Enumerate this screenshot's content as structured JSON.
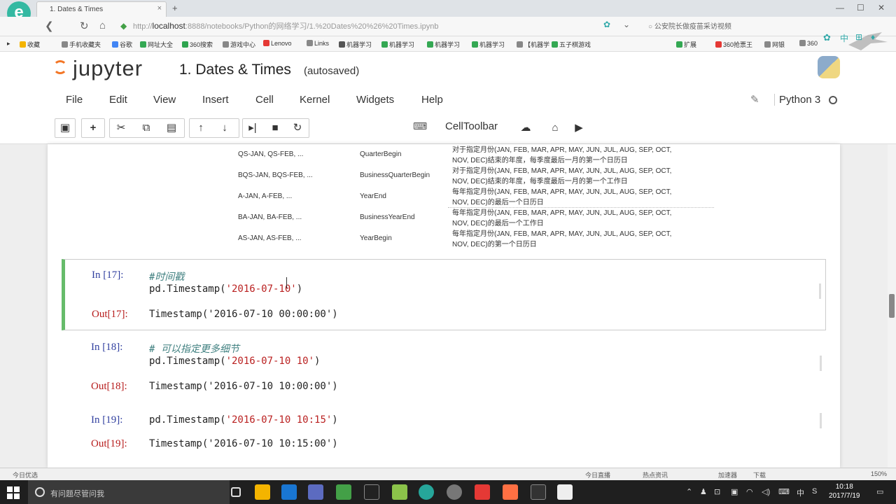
{
  "browser": {
    "tab_title": "1. Dates & Times",
    "tab_close": "×",
    "new_tab": "+",
    "url_scheme": "http://",
    "url_host": "localhost",
    "url_rest": ":8888/notebooks/Python的网络学习/1.%20Dates%20%26%20Times.ipynb",
    "search_text": "公安院长做疫苗采访视频",
    "window_controls": [
      "—",
      "☐",
      "✕"
    ],
    "bookmarks": [
      {
        "label": "收藏",
        "color": "#f4b400"
      },
      {
        "label": "手机收藏夹",
        "color": "#888"
      },
      {
        "label": "谷歌",
        "color": "#4285f4"
      },
      {
        "label": "网址大全",
        "color": "#34a853"
      },
      {
        "label": "360搜索",
        "color": "#2ea44f"
      },
      {
        "label": "游戏中心",
        "color": "#888"
      },
      {
        "label": "Lenovo",
        "color": "#e53935"
      },
      {
        "label": "Links",
        "color": "#888"
      },
      {
        "label": "机器学习",
        "color": "#555"
      },
      {
        "label": "机器学习",
        "color": "#34a853"
      },
      {
        "label": "机器学习",
        "color": "#34a853"
      },
      {
        "label": "机器学习",
        "color": "#34a853"
      },
      {
        "label": "【机器学",
        "color": "#888"
      },
      {
        "label": "五子棋游戏",
        "color": "#34a853"
      },
      {
        "label": "扩展",
        "color": "#34a853"
      },
      {
        "label": "360抢票王",
        "color": "#e53935"
      },
      {
        "label": "网银",
        "color": "#888"
      },
      {
        "label": "360",
        "color": "#888"
      }
    ]
  },
  "jupyter": {
    "logo_text": "jupyter",
    "notebook_title": "1. Dates & Times",
    "save_status": "(autosaved)",
    "kernel_name": "Python 3",
    "menu": [
      "File",
      "Edit",
      "View",
      "Insert",
      "Cell",
      "Kernel",
      "Widgets",
      "Help"
    ],
    "cell_type": "Code",
    "cell_toolbar_label": "CellToolbar"
  },
  "offset_table": {
    "rows": [
      {
        "alias": "QS-JAN, QS-FEB, ...",
        "name": "QuarterBegin",
        "desc1": "对于指定月份(JAN, FEB, MAR, APR, MAY, JUN, JUL, AUG, SEP, OCT,",
        "desc2": "NOV, DEC)结束的年度，每季度最后一月的第一个日历日"
      },
      {
        "alias": "BQS-JAN, BQS-FEB, ...",
        "name": "BusinessQuarterBegin",
        "desc1": "对于指定月份(JAN, FEB, MAR, APR, MAY, JUN, JUL, AUG, SEP, OCT,",
        "desc2": "NOV, DEC)结束的年度，每季度最后一月的第一个工作日"
      },
      {
        "alias": "A-JAN, A-FEB, ...",
        "name": "YearEnd",
        "desc1": "每年指定月份(JAN, FEB, MAR, APR, MAY, JUN, JUL, AUG, SEP, OCT,",
        "desc2": "NOV, DEC)的最后一个日历日"
      },
      {
        "alias": "BA-JAN, BA-FEB, ...",
        "name": "BusinessYearEnd",
        "desc1": "每年指定月份(JAN, FEB, MAR, APR, MAY, JUN, JUL, AUG, SEP, OCT,",
        "desc2": "NOV, DEC)的最后一个工作日"
      },
      {
        "alias": "AS-JAN, AS-FEB, ...",
        "name": "YearBegin",
        "desc1": "每年指定月份(JAN, FEB, MAR, APR, MAY, JUN, JUL, AUG, SEP, OCT,",
        "desc2": "NOV, DEC)的第一个日历日"
      }
    ]
  },
  "cells": [
    {
      "in_prompt": "In [17]:",
      "line1_comment": "#时间戳",
      "line2_pre": "pd.Timestamp(",
      "line2_str": "'2016-07-10'",
      "line2_post": ")",
      "out_prompt": "Out[17]:",
      "output": "Timestamp('2016-07-10 00:00:00')"
    },
    {
      "in_prompt": "In [18]:",
      "line1_comment": "# 可以指定更多细节",
      "line2_pre": "pd.Timestamp(",
      "line2_str": "'2016-07-10 10'",
      "line2_post": ")",
      "out_prompt": "Out[18]:",
      "output": "Timestamp('2016-07-10 10:00:00')"
    },
    {
      "in_prompt": "In [19]:",
      "line2_pre": "pd.Timestamp(",
      "line2_str": "'2016-07-10 10:15'",
      "line2_post": ")",
      "out_prompt": "Out[19]:",
      "output": "Timestamp('2016-07-10 10:15:00')"
    }
  ],
  "statusbar": {
    "left": "今日优选",
    "items": [
      "今日直播",
      "热点资讯",
      "加速器",
      "下载",
      "150%"
    ]
  },
  "taskbar": {
    "search_placeholder": "有问题尽管问我",
    "ime": "中",
    "time": "10:18",
    "date": "2017/7/19"
  }
}
